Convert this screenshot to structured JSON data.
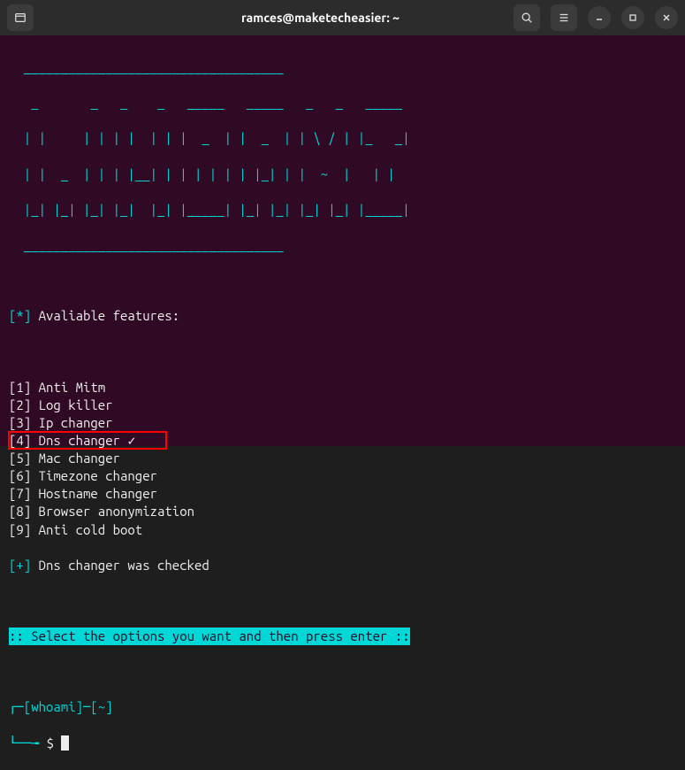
{
  "titlebar": {
    "title": "ramces@maketecheasier: ~"
  },
  "ascii": {
    "hr_top": "  ___________________________________",
    "l1": "   _       _   _    _   _____   _____   _   _   _____ ",
    "l2": "  | |     | | | |  | | |  _  | |  _  | | \\ / | |_   _|",
    "l3": "  | |  _  | | | |__| | | | | | | |_| | |  ~  |   | |  ",
    "l4": "  |_| |_| |_| |_|  |_| |_____| |_| |_| |_| |_| |_____|",
    "hr_bot": "  ___________________________________"
  },
  "header": {
    "prefix": "[*]",
    "text": " Avaliable features:"
  },
  "features": [
    {
      "idx": "[1]",
      "text": " Anti Mitm"
    },
    {
      "idx": "[2]",
      "text": " Log killer"
    },
    {
      "idx": "[3]",
      "text": " Ip changer"
    },
    {
      "idx": "[4]",
      "text": " Dns changer ",
      "checked": "✓",
      "highlight": true
    },
    {
      "idx": "[5]",
      "text": " Mac changer"
    },
    {
      "idx": "[6]",
      "text": " Timezone changer"
    },
    {
      "idx": "[7]",
      "text": " Hostname changer"
    },
    {
      "idx": "[8]",
      "text": " Browser anonymization"
    },
    {
      "idx": "[9]",
      "text": " Anti cold boot"
    }
  ],
  "status": {
    "prefix": "[+]",
    "text": " Dns changer was checked"
  },
  "instruction": ":: Select the options you want and then press enter ::",
  "prompt": {
    "l1_a": "┌─[",
    "l1_b": "whoami",
    "l1_c": "]─[",
    "l1_d": "~",
    "l1_e": "]",
    "l2_a": "└──╼ ",
    "l2_b": "$ "
  }
}
